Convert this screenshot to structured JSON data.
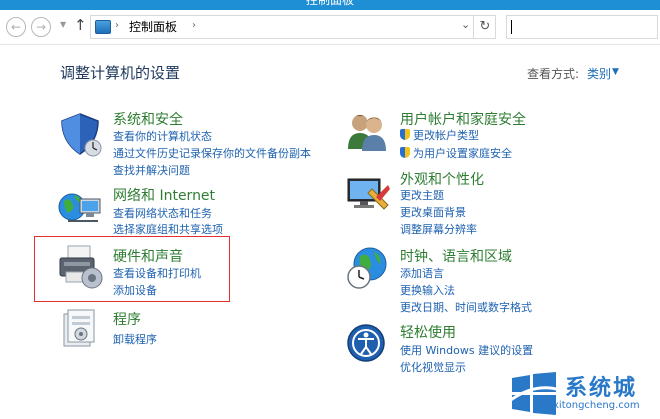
{
  "window": {
    "title": "控制面板"
  },
  "navbar": {
    "back_glyph": "←",
    "forward_glyph": "→",
    "up_glyph": "↑",
    "breadcrumb": "控制面板",
    "separator": "›",
    "dropdown_glyph": "⌄",
    "refresh_glyph": "↻"
  },
  "main": {
    "heading": "调整计算机的设置",
    "view_by_label": "查看方式:",
    "view_by_value": "类别"
  },
  "categories": [
    {
      "title": "系统和安全",
      "icon": "shield-icon",
      "links": [
        "查看你的计算机状态",
        "通过文件历史记录保存你的文件备份副本",
        "查找并解决问题"
      ]
    },
    {
      "title": "网络和 Internet",
      "icon": "network-icon",
      "links": [
        "查看网络状态和任务",
        "选择家庭组和共享选项"
      ]
    },
    {
      "title": "硬件和声音",
      "icon": "printer-icon",
      "links": [
        "查看设备和打印机",
        "添加设备"
      ]
    },
    {
      "title": "程序",
      "icon": "programs-icon",
      "links": [
        "卸载程序"
      ]
    },
    {
      "title": "用户帐户和家庭安全",
      "icon": "users-icon",
      "links": [
        "更改帐户类型",
        "为用户设置家庭安全"
      ]
    },
    {
      "title": "外观和个性化",
      "icon": "appearance-icon",
      "links": [
        "更改主题",
        "更改桌面背景",
        "调整屏幕分辨率"
      ]
    },
    {
      "title": "时钟、语言和区域",
      "icon": "clock-globe-icon",
      "links": [
        "添加语言",
        "更换输入法",
        "更改日期、时间或数字格式"
      ]
    },
    {
      "title": "轻松使用",
      "icon": "ease-of-access-icon",
      "links": [
        "使用 Windows 建议的设置",
        "优化视觉显示"
      ]
    }
  ],
  "watermark": {
    "text": "系统城",
    "url": "xitongcheng.com"
  },
  "colors": {
    "category_title": "#2e7d32",
    "link": "#1e62b0",
    "highlight_border": "#e03030",
    "titlebar": "#1f8fd5"
  }
}
